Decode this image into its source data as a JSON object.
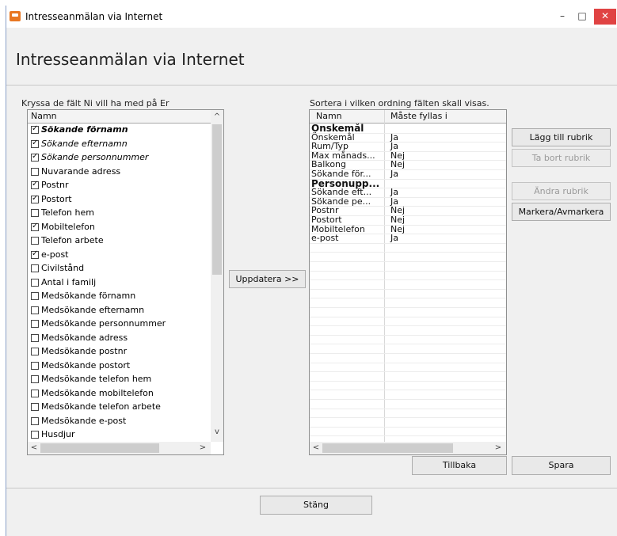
{
  "window": {
    "title": "Intresseanmälan via Internet",
    "min": "–",
    "max": "□",
    "close": "✕"
  },
  "heading": "Intresseanmälan via Internet",
  "left": {
    "label": "Kryssa de fält Ni vill ha med på Er",
    "column": "Namn",
    "items": [
      {
        "label": "Sökande förnamn",
        "checked": true,
        "style": "bold-italic"
      },
      {
        "label": "Sökande efternamn",
        "checked": true,
        "style": "italic"
      },
      {
        "label": "Sökande personnummer",
        "checked": true,
        "style": "italic"
      },
      {
        "label": "Nuvarande adress",
        "checked": false,
        "style": ""
      },
      {
        "label": "Postnr",
        "checked": true,
        "style": ""
      },
      {
        "label": "Postort",
        "checked": true,
        "style": ""
      },
      {
        "label": "Telefon hem",
        "checked": false,
        "style": ""
      },
      {
        "label": "Mobiltelefon",
        "checked": true,
        "style": ""
      },
      {
        "label": "Telefon arbete",
        "checked": false,
        "style": ""
      },
      {
        "label": "e-post",
        "checked": true,
        "style": ""
      },
      {
        "label": "Civilstånd",
        "checked": false,
        "style": ""
      },
      {
        "label": "Antal i familj",
        "checked": false,
        "style": ""
      },
      {
        "label": "Medsökande förnamn",
        "checked": false,
        "style": ""
      },
      {
        "label": "Medsökande efternamn",
        "checked": false,
        "style": ""
      },
      {
        "label": "Medsökande personnummer",
        "checked": false,
        "style": ""
      },
      {
        "label": "Medsökande adress",
        "checked": false,
        "style": ""
      },
      {
        "label": "Medsökande postnr",
        "checked": false,
        "style": ""
      },
      {
        "label": "Medsökande postort",
        "checked": false,
        "style": ""
      },
      {
        "label": "Medsökande telefon hem",
        "checked": false,
        "style": ""
      },
      {
        "label": "Medsökande mobiltelefon",
        "checked": false,
        "style": ""
      },
      {
        "label": "Medsökande telefon arbete",
        "checked": false,
        "style": ""
      },
      {
        "label": "Medsökande e-post",
        "checked": false,
        "style": ""
      },
      {
        "label": "Husdjur",
        "checked": false,
        "style": ""
      }
    ]
  },
  "update_button": "Uppdatera >>",
  "right": {
    "label": "Sortera i vilken ordning fälten skall visas.",
    "columns": [
      "Namn",
      "Måste fyllas i"
    ],
    "rows": [
      {
        "name": "Önskemål",
        "required": "",
        "header": true
      },
      {
        "name": "Önskemål",
        "required": "Ja",
        "header": false
      },
      {
        "name": "Rum/Typ",
        "required": "Ja",
        "header": false
      },
      {
        "name": "Max månads...",
        "required": "Nej",
        "header": false
      },
      {
        "name": "Balkong",
        "required": "Nej",
        "header": false
      },
      {
        "name": "Sökande för...",
        "required": "Ja",
        "header": false
      },
      {
        "name": "Personupp...",
        "required": "",
        "header": true
      },
      {
        "name": "Sökande eft...",
        "required": "Ja",
        "header": false
      },
      {
        "name": "Sökande pe...",
        "required": "Ja",
        "header": false
      },
      {
        "name": "Postnr",
        "required": "Nej",
        "header": false
      },
      {
        "name": "Postort",
        "required": "Nej",
        "header": false
      },
      {
        "name": "Mobiltelefon",
        "required": "Nej",
        "header": false
      },
      {
        "name": "e-post",
        "required": "Ja",
        "header": false
      }
    ]
  },
  "side_buttons": {
    "add_heading": "Lägg till rubrik",
    "remove_heading": "Ta bort rubrik",
    "edit_heading": "Ändra rubrik",
    "toggle_mark": "Markera/Avmarkera"
  },
  "back_button": "Tillbaka",
  "save_button": "Spara",
  "close_button": "Stäng",
  "arrows": {
    "up": "^",
    "down": "v",
    "left": "<",
    "right": ">"
  }
}
